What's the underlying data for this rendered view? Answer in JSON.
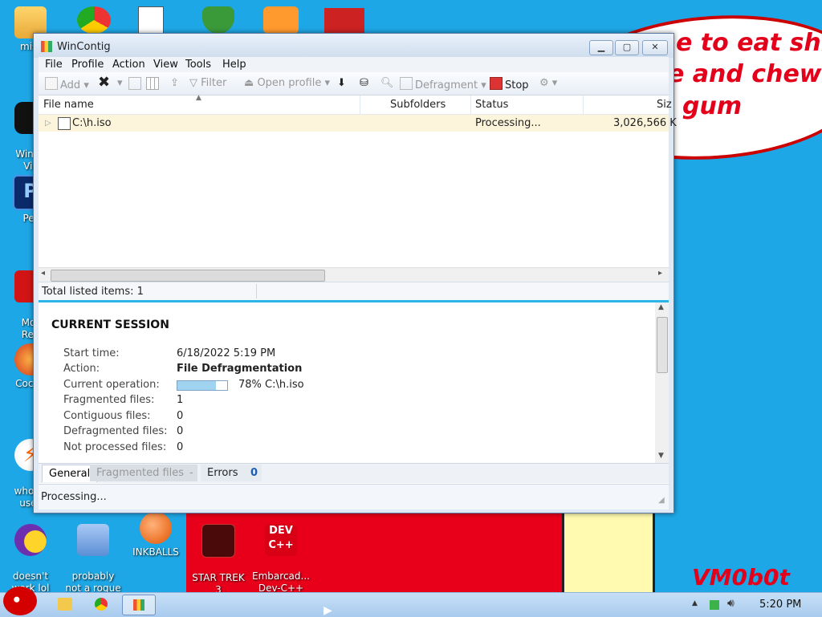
{
  "wallpaper": {
    "bubble_lines": [
      "e to eat shit",
      "e and chew",
      "gum"
    ],
    "signature": "VM0b0t"
  },
  "desktop_icons": [
    {
      "label": "mist",
      "icon": "folder-icon"
    },
    {
      "label": "Windo\nVis",
      "icon": "windows-icon"
    },
    {
      "label": "Per",
      "icon": "photoshop-icon"
    },
    {
      "label": "Mor\nRea",
      "icon": "pdf-icon"
    },
    {
      "label": "CockC",
      "icon": "game-icon"
    },
    {
      "label": "who th\nuses",
      "icon": "lightning-icon"
    },
    {
      "label": "doesn't\nwork lol",
      "icon": "yahoo-icon"
    },
    {
      "label": "probably\nnot a rogue",
      "icon": "settings-icon"
    },
    {
      "label": "INKBALLS",
      "icon": "inkball-icon"
    },
    {
      "label": "STAR TREK\n3",
      "icon": "starwars-icon"
    },
    {
      "label": "Embarcad...\nDev-C++",
      "icon": "devcpp-icon"
    }
  ],
  "window": {
    "title": "WinContig",
    "menu": [
      "File",
      "Profile",
      "Action",
      "View",
      "Tools",
      "Help"
    ],
    "toolbar": {
      "add": "Add",
      "filter": "Filter",
      "open_profile": "Open profile",
      "defragment": "Defragment",
      "stop": "Stop"
    },
    "columns": [
      "File name",
      "Subfolders",
      "Status",
      "Siz"
    ],
    "rows": [
      {
        "name": "C:\\h.iso",
        "subfolders": "",
        "status": "Processing...",
        "size": "3,026,566 K"
      }
    ],
    "list_status": "Total listed items: 1",
    "session": {
      "heading": "CURRENT SESSION",
      "start_label": "Start time:",
      "start_value": "6/18/2022 5:19 PM",
      "action_label": "Action:",
      "action_value": "File Defragmentation",
      "operation_label": "Current operation:",
      "operation_progress": 0.78,
      "operation_text": "78%  C:\\h.iso",
      "fragmented_label": "Fragmented files:",
      "fragmented_value": "1",
      "contiguous_label": "Contiguous files:",
      "contiguous_value": "0",
      "defragmented_label": "Defragmented files:",
      "defragmented_value": "0",
      "not_processed_label": "Not processed files:",
      "not_processed_value": "0"
    },
    "tabs": {
      "general": "General",
      "fragmented": "Fragmented files",
      "fragmented_sep": "-",
      "errors": "Errors",
      "errors_count": "0"
    },
    "status": "Processing..."
  },
  "taskbar": {
    "clock": "5:20 PM"
  },
  "colors": {
    "desktop": "#1ea7e6",
    "accent": "#2bb5e6",
    "wallpaper_red": "#e8001a"
  }
}
